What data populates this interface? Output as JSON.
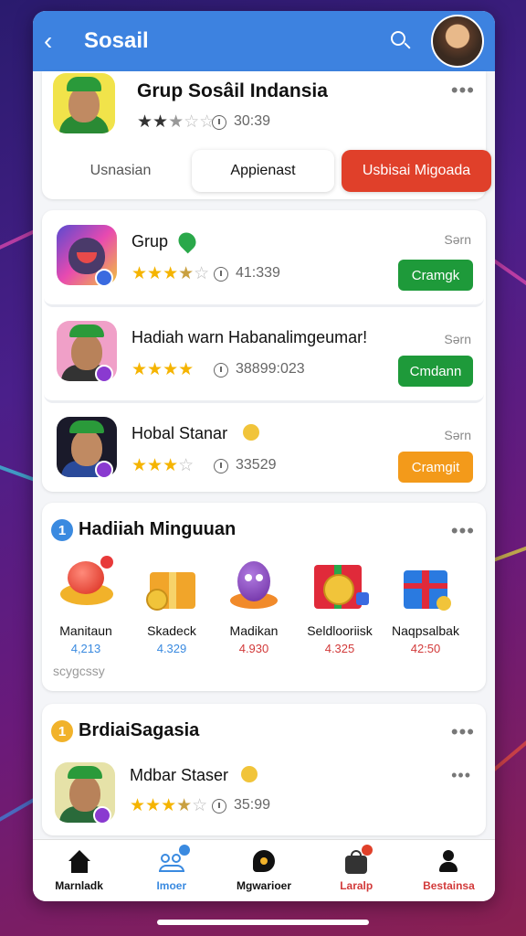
{
  "header": {
    "title": "Sosail",
    "back_icon": "chevron-left-icon",
    "search_icon": "search-icon"
  },
  "group": {
    "name": "Grup Sosâil Indansia",
    "rating_icons": "★★★☆☆",
    "time": "30:39",
    "tabs": [
      {
        "label": "Usnasian"
      },
      {
        "label": "Appienast"
      },
      {
        "label": "Usbisai Migoada"
      }
    ]
  },
  "list": [
    {
      "name": "Grup",
      "sub": "Sərn",
      "meta": "41:339",
      "button": "Cramgk",
      "button_color": "#1e9a3a",
      "stars": 3.5
    },
    {
      "name": "Hadiah warn Habanalimgeumar!",
      "sub": "Sərn",
      "meta": "38899:023",
      "button": "Cmdann",
      "button_color": "#1e9a3a",
      "stars": 4
    },
    {
      "name": "Hobal Stanar",
      "sub": "Sərn",
      "meta": "33529",
      "button": "Cramgit",
      "button_color": "#f39a1a",
      "stars": 3
    }
  ],
  "rewards": {
    "number": "1",
    "title": "Hadiiah Minguuan",
    "items": [
      {
        "label": "Manitaun",
        "value": "4,213",
        "color": "#3a8ae0"
      },
      {
        "label": "Skadeck",
        "value": "4.329",
        "color": "#3a8ae0"
      },
      {
        "label": "Madikan",
        "value": "4.930",
        "color": "#d23a3a"
      },
      {
        "label": "Seldlooriisk",
        "value": "4.325",
        "color": "#d23a3a"
      },
      {
        "label": "Naqpsalbak",
        "value": "42:50",
        "color": "#d23a3a"
      }
    ],
    "footer": "scygcssy"
  },
  "bottom_section": {
    "number": "1",
    "title": "BrdiaiSagasia",
    "item": {
      "name": "Mdbar Staser",
      "meta": "35:99",
      "stars": 3.5
    }
  },
  "nav": [
    {
      "label": "Marnladk",
      "color": "#111111",
      "icon": "home-icon"
    },
    {
      "label": "Imoer",
      "color": "#3a8ae0",
      "icon": "people-icon"
    },
    {
      "label": "Mgwarioer",
      "color": "#111111",
      "icon": "chat-icon"
    },
    {
      "label": "Laralp",
      "color": "#d23a3a",
      "icon": "bag-icon"
    },
    {
      "label": "Bestainsa",
      "color": "#d23a3a",
      "icon": "profile-icon"
    }
  ]
}
